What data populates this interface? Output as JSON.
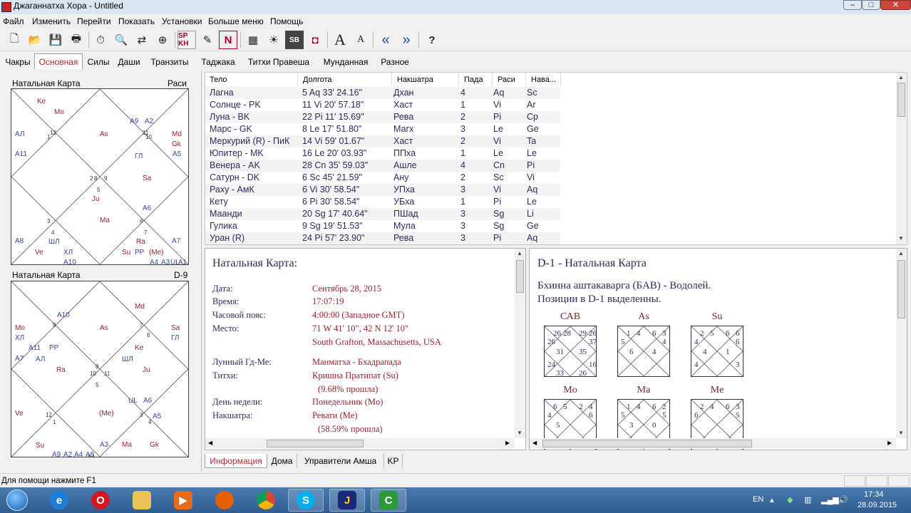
{
  "window": {
    "title": "Джаганнатха Хора - Untitled"
  },
  "menu": [
    "Файл",
    "Изменить",
    "Перейти",
    "Показать",
    "Установки",
    "Больше меню",
    "Помощь"
  ],
  "toolbar": {
    "sp_kh": "SP KH",
    "n_label": "N",
    "sb_label": "SB",
    "font_big": "A",
    "font_small": "A",
    "help": "?"
  },
  "tabs": [
    "Чакры",
    "Основная",
    "Силы",
    "Даши",
    "Транзиты",
    "Таджака",
    "Титхи Правеша",
    "Мунданная",
    "Разное"
  ],
  "left_charts": {
    "rasi": {
      "title": "Натальная Карта",
      "label": "Раси",
      "texts": [
        "Ke",
        "Mo",
        "АЛ",
        "A11",
        "A9",
        "A2",
        "Md",
        "Gk",
        "A5",
        "As",
        "ГЛ",
        "Sa",
        "Ju",
        "A6",
        "Ma",
        "A8",
        "ШЛ",
        "Ve",
        "ХЛ",
        "A10",
        "Ra",
        "Su",
        "PP",
        "(Me)",
        "A7",
        "A4",
        "A3",
        "UL",
        "A1",
        "12",
        "1",
        "11",
        "10",
        "2",
        "5",
        "8",
        "3",
        "4",
        "6",
        "7",
        "9"
      ]
    },
    "navamsa": {
      "title": "Натальная Карта",
      "label": "D-9",
      "texts": [
        "Md",
        "A10",
        "Mo",
        "ХЛ",
        "A11",
        "A7",
        "АЛ",
        "PP",
        "As",
        "Sa",
        "ГЛ",
        "Ke",
        "ШЛ",
        "Ra",
        "Ju",
        "UL",
        "A6",
        "Ve",
        "(Me)",
        "A5",
        "Su",
        "A9",
        "A2",
        "A4",
        "A8",
        "A3",
        "Ma",
        "Gk",
        "A1",
        "9",
        "7",
        "6",
        "8",
        "10",
        "11",
        "5",
        "12",
        "1",
        "3",
        "4",
        "2"
      ]
    }
  },
  "planets_table": {
    "headers": [
      "Тело",
      "Долгота",
      "Накшатра",
      "Пада",
      "Раси",
      "Нава..."
    ],
    "rows": [
      [
        "Лагна",
        "5 Aq 33' 24.16\"",
        "Дхан",
        "4",
        "Aq",
        "Sc"
      ],
      [
        "Солнце - PK",
        "11 Vi 20' 57.18\"",
        "Хаст",
        "1",
        "Vi",
        "Ar"
      ],
      [
        "Луна - BK",
        "22 Pi 11' 15.69\"",
        "Рева",
        "2",
        "Pi",
        "Cp"
      ],
      [
        "Марс - GK",
        "8 Le 17' 51.80\"",
        "Магх",
        "3",
        "Le",
        "Ge"
      ],
      [
        "Меркурий (R) - ПиК",
        "14 Vi 59' 01.67\"",
        "Хаст",
        "2",
        "Vi",
        "Ta"
      ],
      [
        "Юпитер - MK",
        "16 Le 20' 03.93\"",
        "ППха",
        "1",
        "Le",
        "Le"
      ],
      [
        "Венера - AK",
        "28 Cn 35' 59.03\"",
        "Ашле",
        "4",
        "Cn",
        "Pi"
      ],
      [
        "Сатурн - DK",
        "6 Sc 45' 21.59\"",
        "Ану",
        "2",
        "Sc",
        "Vi"
      ],
      [
        "Раху - АмК",
        "6 Vi 30' 58.54\"",
        "УПха",
        "3",
        "Vi",
        "Aq"
      ],
      [
        "Кету",
        "6 Pi 30' 58.54\"",
        "УБха",
        "1",
        "Pi",
        "Le"
      ],
      [
        "Маанди",
        "20 Sg 17' 40.64\"",
        "ПШад",
        "3",
        "Sg",
        "Li"
      ],
      [
        "Гулика",
        "9 Sg 19' 51.53\"",
        "Мула",
        "3",
        "Sg",
        "Ge"
      ],
      [
        "Уран (R)",
        "24 Pi 57' 23.90\"",
        "Рева",
        "3",
        "Pi",
        "Aq"
      ]
    ]
  },
  "info": {
    "title": "Натальная Карта:",
    "date_k": "Дата:",
    "date_v": "Сентябрь 28, 2015",
    "time_k": "Время:",
    "time_v": "17:07:19",
    "tz_k": "Часовой пояс:",
    "tz_v": "4:00:00 (Западное GMT)",
    "place_k": "Место:",
    "place_v": "71 W 41' 10\", 42 N 12' 10\"",
    "place_v2": "South Grafton, Massachusetts, USA",
    "lunar_k": "Лунный Гд-Ме:",
    "lunar_v": "Манматха - Бхадрапада",
    "tithi_k": "Титхи:",
    "tithi_v": "Кришна Пратипат (Su)",
    "tithi_v2": "(9.68% прошла)",
    "day_k": "День недели:",
    "day_v": "Понедельник (Mo)",
    "nak_k": "Накшатра:",
    "nak_v": "Ревати (Me)",
    "nak_v2": "(58.59% прошла)"
  },
  "bav": {
    "title": "D-1 - Натальная Карта",
    "line1": "Бхинна аштакаварга (БАВ) - Водолей.",
    "line2": "Позиции в D-1 выделенны.",
    "grids": [
      {
        "label": "САВ",
        "nums": [
          "26",
          "28",
          "29",
          "26",
          "26",
          "37",
          "31",
          "35",
          "24",
          "16",
          "33",
          "26"
        ]
      },
      {
        "label": "As",
        "nums": [
          "1",
          "4",
          "6",
          "3",
          "5",
          "4",
          "6",
          "4"
        ]
      },
      {
        "label": "Su",
        "nums": [
          "2",
          "5",
          "6",
          "6",
          "4",
          "6",
          "4",
          "1",
          "4",
          "3"
        ]
      },
      {
        "label": "Mo",
        "nums": [
          "6",
          "5",
          "2",
          "4",
          "4",
          "6",
          "5"
        ]
      },
      {
        "label": "Ma",
        "nums": [
          "1",
          "4",
          "6",
          "2",
          "5",
          "5",
          "3",
          "0"
        ]
      },
      {
        "label": "Me",
        "nums": [
          "2",
          "4",
          "6",
          "3",
          "6",
          "5"
        ]
      }
    ]
  },
  "bottom_tabs": [
    "Информация",
    "Дома",
    "Управители Амша",
    "KP"
  ],
  "status": {
    "text": "Для помощи нажмите F1"
  },
  "taskbar": {
    "lang": "EN",
    "time": "17:34",
    "date": "28.09.2015"
  },
  "colors": {
    "accent_red": "#b8282e",
    "dark_blue_text": "#2c2c5c",
    "chart_red": "#9b2030"
  }
}
